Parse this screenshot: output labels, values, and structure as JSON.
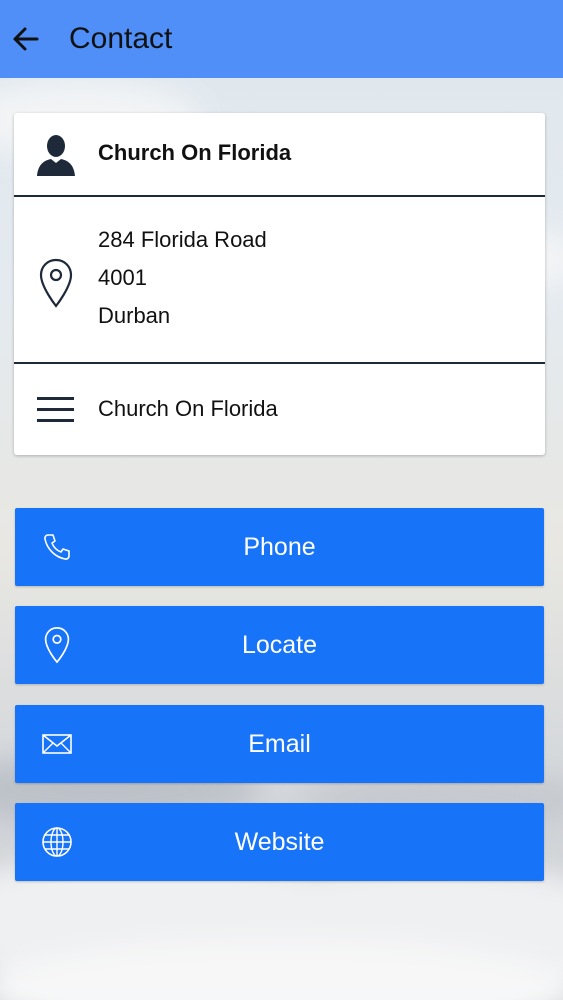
{
  "header": {
    "title": "Contact"
  },
  "contact": {
    "name": "Church On Florida",
    "address_lines": [
      "284 Florida Road",
      "4001",
      "Durban"
    ],
    "description": "Church On Florida"
  },
  "actions": [
    {
      "label": "Phone",
      "icon": "phone-icon"
    },
    {
      "label": "Locate",
      "icon": "location-pin-icon"
    },
    {
      "label": "Email",
      "icon": "envelope-icon"
    },
    {
      "label": "Website",
      "icon": "globe-icon"
    }
  ],
  "colors": {
    "appbar": "#4f8ff7",
    "button": "#1773f7",
    "icon_dark": "#1e2a3a"
  }
}
